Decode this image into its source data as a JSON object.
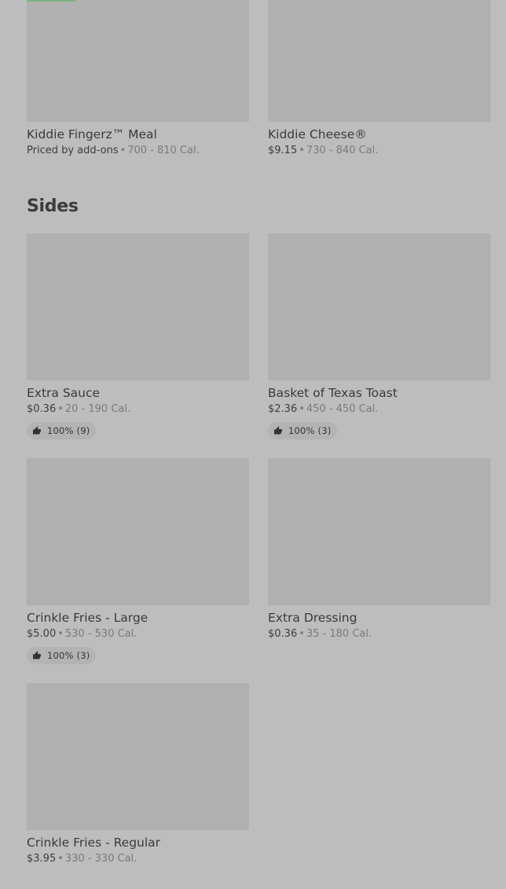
{
  "top_items": [
    {
      "title": "Kiddie Fingerz™ Meal",
      "price": "Priced by add-ons",
      "calories": "700 - 810 Cal."
    },
    {
      "title": "Kiddie Cheese®",
      "price": "$9.15",
      "calories": "730 - 840 Cal."
    }
  ],
  "sides": {
    "heading": "Sides",
    "items": [
      {
        "title": "Extra Sauce",
        "price": "$0.36",
        "calories": "20 - 190 Cal.",
        "rating": "100% (9)"
      },
      {
        "title": "Basket of Texas Toast",
        "price": "$2.36",
        "calories": "450 - 450 Cal.",
        "rating": "100% (3)"
      },
      {
        "title": "Crinkle Fries - Large",
        "price": "$5.00",
        "calories": "530 - 530 Cal.",
        "rating": "100% (3)"
      },
      {
        "title": "Extra Dressing",
        "price": "$0.36",
        "calories": "35 - 180 Cal."
      },
      {
        "title": "Crinkle Fries - Regular",
        "price": "$3.95",
        "calories": "330 - 330 Cal."
      }
    ]
  },
  "separator": "•",
  "icons": {
    "rating": "thumbs-up-icon"
  },
  "colors": {
    "background": "#bdbdbd",
    "image_placeholder": "#b0b0b0",
    "accent_tag": "#7bb37f"
  }
}
